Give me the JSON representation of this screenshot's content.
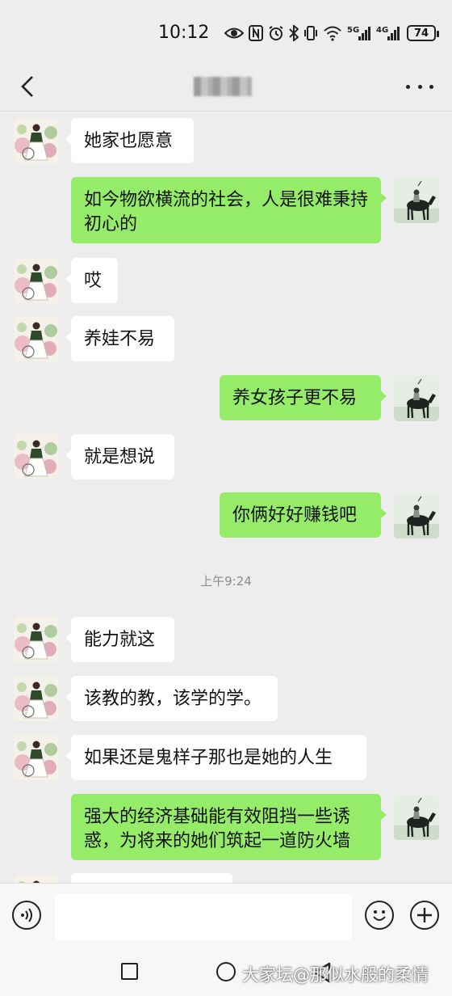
{
  "status_bar": {
    "time": "10:12",
    "icons": [
      "eye-icon",
      "nfc-icon",
      "alarm-icon",
      "bluetooth-icon",
      "vibrate-icon",
      "wifi-icon",
      "5g-signal-icon",
      "4g-signal-icon"
    ],
    "network_5g": "5G",
    "network_4g": "4G",
    "battery": "74"
  },
  "header": {
    "back_icon": "chevron-left-icon",
    "more_icon": "more-dots-icon"
  },
  "messages": [
    {
      "side": "in",
      "text": "她家也愿意"
    },
    {
      "side": "out",
      "text": "如今物欲横流的社会，人是很难秉持初心的"
    },
    {
      "side": "in",
      "text": "哎"
    },
    {
      "side": "in",
      "text": "养娃不易"
    },
    {
      "side": "out",
      "text": "养女孩子更不易"
    },
    {
      "side": "in",
      "text": "就是想说"
    },
    {
      "side": "out",
      "text": "你俩好好赚钱吧"
    },
    {
      "side": "in",
      "text": "能力就这"
    },
    {
      "side": "in",
      "text": "该教的教，该学的学。"
    },
    {
      "side": "in",
      "text": "如果还是鬼样子那也是她的人生"
    },
    {
      "side": "out",
      "text": "强大的经济基础能有效阻挡一些诱惑，为将来的她们筑起一道防火墙"
    }
  ],
  "timestamp": "上午9:24",
  "input_bar": {
    "voice_icon": "voice-icon",
    "emoji_icon": "emoji-icon",
    "plus_icon": "plus-icon",
    "input_value": ""
  },
  "nav_bar": {
    "icons": [
      "recent-apps-icon",
      "home-icon",
      "back-triangle-icon"
    ]
  },
  "watermark": "大家坛@那似水般的柔情",
  "colors": {
    "background": "#ededed",
    "outgoing_bubble": "#95ec69",
    "incoming_bubble": "#ffffff"
  }
}
